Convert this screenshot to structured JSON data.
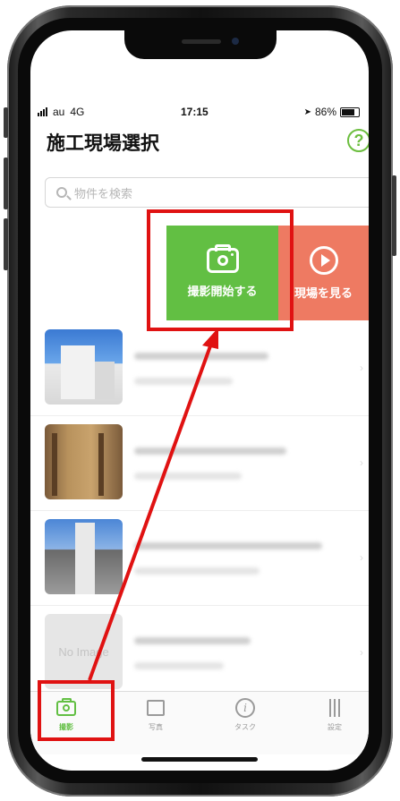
{
  "status_bar": {
    "carrier": "au",
    "network": "4G",
    "time": "17:15",
    "battery": "86%",
    "battery_level": 0.86
  },
  "header": {
    "title": "施工現場選択",
    "help_label": "?"
  },
  "search": {
    "placeholder": "物件を検索"
  },
  "swipe_actions": {
    "shoot_label": "撮影開始する",
    "view_label": "現場を見る"
  },
  "sites": [
    {
      "thumbnail": "photo"
    },
    {
      "thumbnail": "photo"
    },
    {
      "thumbnail": "photo"
    },
    {
      "thumbnail": "none",
      "no_image_label": "No Image"
    }
  ],
  "tabbar": {
    "tabs": [
      {
        "label": "撮影",
        "icon": "camera-icon",
        "active": true
      },
      {
        "label": "写真",
        "icon": "photo-icon",
        "active": false
      },
      {
        "label": "タスク",
        "icon": "info-icon",
        "active": false
      },
      {
        "label": "設定",
        "icon": "sliders-icon",
        "active": false
      }
    ]
  },
  "colors": {
    "accent_green": "#62bf43",
    "view_action": "#ee7a62",
    "annotation_red": "#e01212"
  }
}
